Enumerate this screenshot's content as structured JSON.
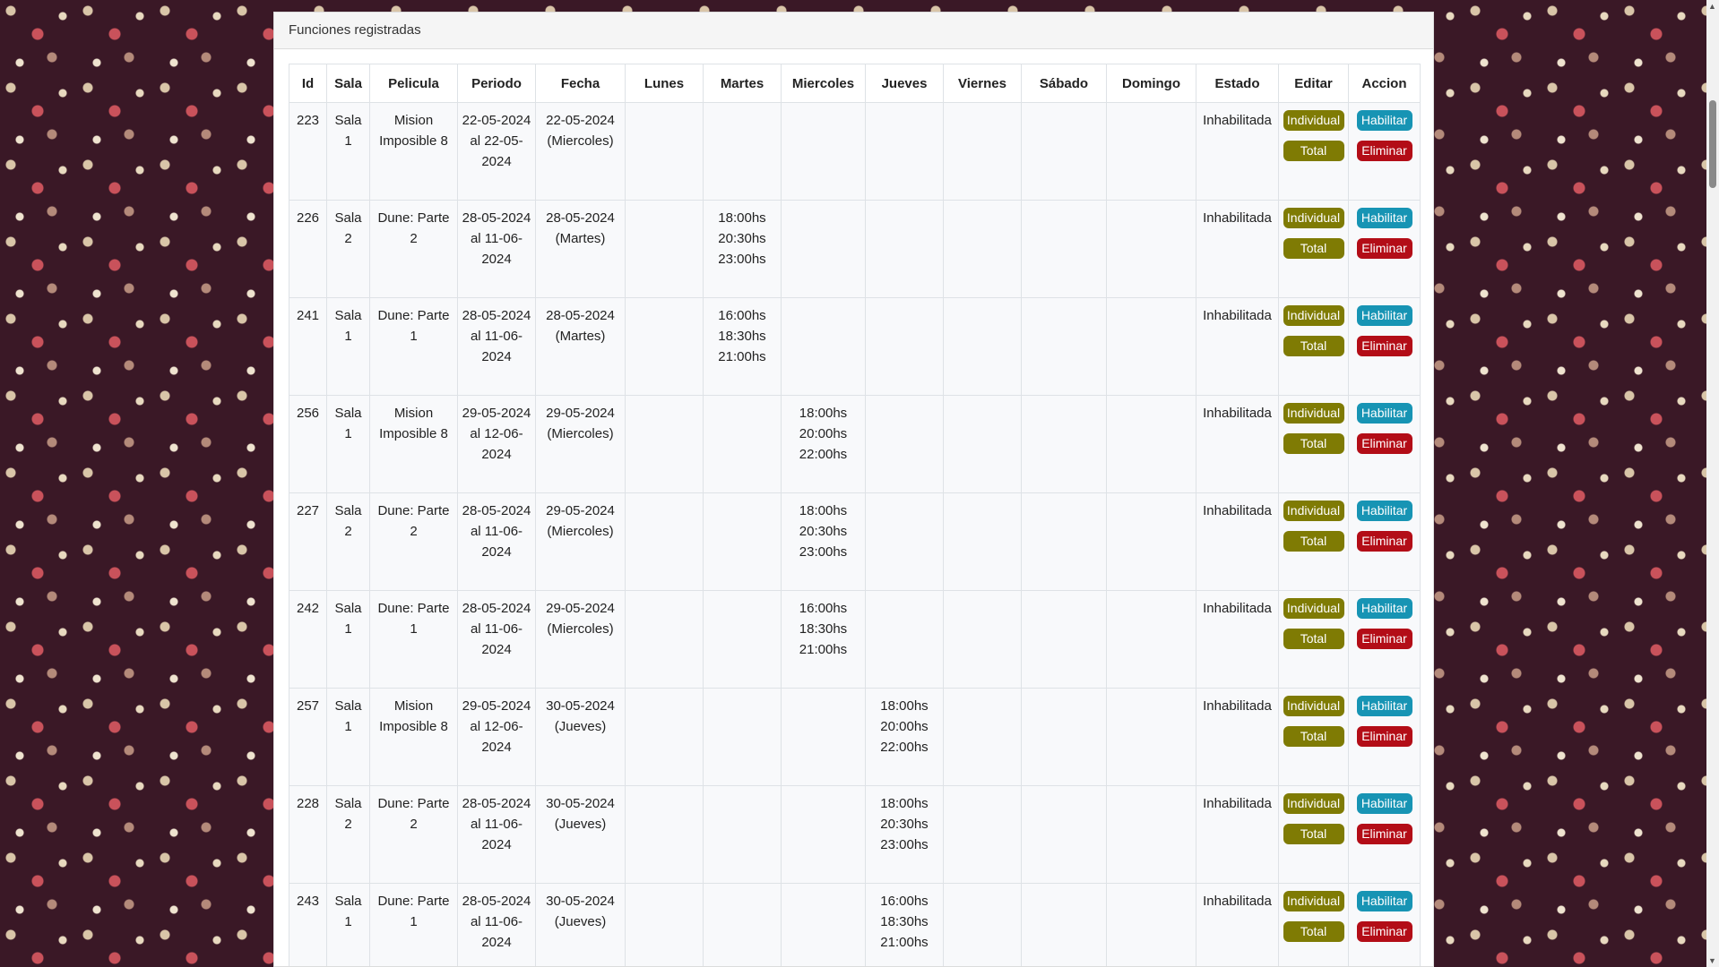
{
  "panel": {
    "title": "Funciones registradas"
  },
  "columns": [
    "Id",
    "Sala",
    "Pelicula",
    "Periodo",
    "Fecha",
    "Lunes",
    "Martes",
    "Miercoles",
    "Jueves",
    "Viernes",
    "Sábado",
    "Domingo",
    "Estado",
    "Editar",
    "Accion"
  ],
  "buttons": {
    "individual": "Individual",
    "total": "Total",
    "habilitar": "Habilitar",
    "eliminar": "Eliminar"
  },
  "rows": [
    {
      "id": "223",
      "sala": "Sala 1",
      "pelicula": "Mision Imposible 8",
      "periodo": "22-05-2024 al 22-05-2024",
      "fecha": "22-05-2024 (Miercoles)",
      "lunes": "",
      "martes": "",
      "miercoles": "",
      "jueves": "",
      "viernes": "",
      "sabado": "",
      "domingo": "",
      "estado": "Inhabilitada"
    },
    {
      "id": "226",
      "sala": "Sala 2",
      "pelicula": "Dune: Parte 2",
      "periodo": "28-05-2024 al 11-06-2024",
      "fecha": "28-05-2024 (Martes)",
      "lunes": "",
      "martes": "18:00hs\n20:30hs\n23:00hs",
      "miercoles": "",
      "jueves": "",
      "viernes": "",
      "sabado": "",
      "domingo": "",
      "estado": "Inhabilitada"
    },
    {
      "id": "241",
      "sala": "Sala 1",
      "pelicula": "Dune: Parte 1",
      "periodo": "28-05-2024 al 11-06-2024",
      "fecha": "28-05-2024 (Martes)",
      "lunes": "",
      "martes": "16:00hs\n18:30hs\n21:00hs",
      "miercoles": "",
      "jueves": "",
      "viernes": "",
      "sabado": "",
      "domingo": "",
      "estado": "Inhabilitada"
    },
    {
      "id": "256",
      "sala": "Sala 1",
      "pelicula": "Mision Imposible 8",
      "periodo": "29-05-2024 al 12-06-2024",
      "fecha": "29-05-2024 (Miercoles)",
      "lunes": "",
      "martes": "",
      "miercoles": "18:00hs\n20:00hs\n22:00hs",
      "jueves": "",
      "viernes": "",
      "sabado": "",
      "domingo": "",
      "estado": "Inhabilitada"
    },
    {
      "id": "227",
      "sala": "Sala 2",
      "pelicula": "Dune: Parte 2",
      "periodo": "28-05-2024 al 11-06-2024",
      "fecha": "29-05-2024 (Miercoles)",
      "lunes": "",
      "martes": "",
      "miercoles": "18:00hs\n20:30hs\n23:00hs",
      "jueves": "",
      "viernes": "",
      "sabado": "",
      "domingo": "",
      "estado": "Inhabilitada"
    },
    {
      "id": "242",
      "sala": "Sala 1",
      "pelicula": "Dune: Parte 1",
      "periodo": "28-05-2024 al 11-06-2024",
      "fecha": "29-05-2024 (Miercoles)",
      "lunes": "",
      "martes": "",
      "miercoles": "16:00hs\n18:30hs\n21:00hs",
      "jueves": "",
      "viernes": "",
      "sabado": "",
      "domingo": "",
      "estado": "Inhabilitada"
    },
    {
      "id": "257",
      "sala": "Sala 1",
      "pelicula": "Mision Imposible 8",
      "periodo": "29-05-2024 al 12-06-2024",
      "fecha": "30-05-2024 (Jueves)",
      "lunes": "",
      "martes": "",
      "miercoles": "",
      "jueves": "18:00hs\n20:00hs\n22:00hs",
      "viernes": "",
      "sabado": "",
      "domingo": "",
      "estado": "Inhabilitada"
    },
    {
      "id": "228",
      "sala": "Sala 2",
      "pelicula": "Dune: Parte 2",
      "periodo": "28-05-2024 al 11-06-2024",
      "fecha": "30-05-2024 (Jueves)",
      "lunes": "",
      "martes": "",
      "miercoles": "",
      "jueves": "18:00hs\n20:30hs\n23:00hs",
      "viernes": "",
      "sabado": "",
      "domingo": "",
      "estado": "Inhabilitada"
    },
    {
      "id": "243",
      "sala": "Sala 1",
      "pelicula": "Dune: Parte 1",
      "periodo": "28-05-2024 al 11-06-2024",
      "fecha": "30-05-2024 (Jueves)",
      "lunes": "",
      "martes": "",
      "miercoles": "",
      "jueves": "16:00hs\n18:30hs\n21:00hs",
      "viernes": "",
      "sabado": "",
      "domingo": "",
      "estado": "Inhabilitada"
    }
  ]
}
